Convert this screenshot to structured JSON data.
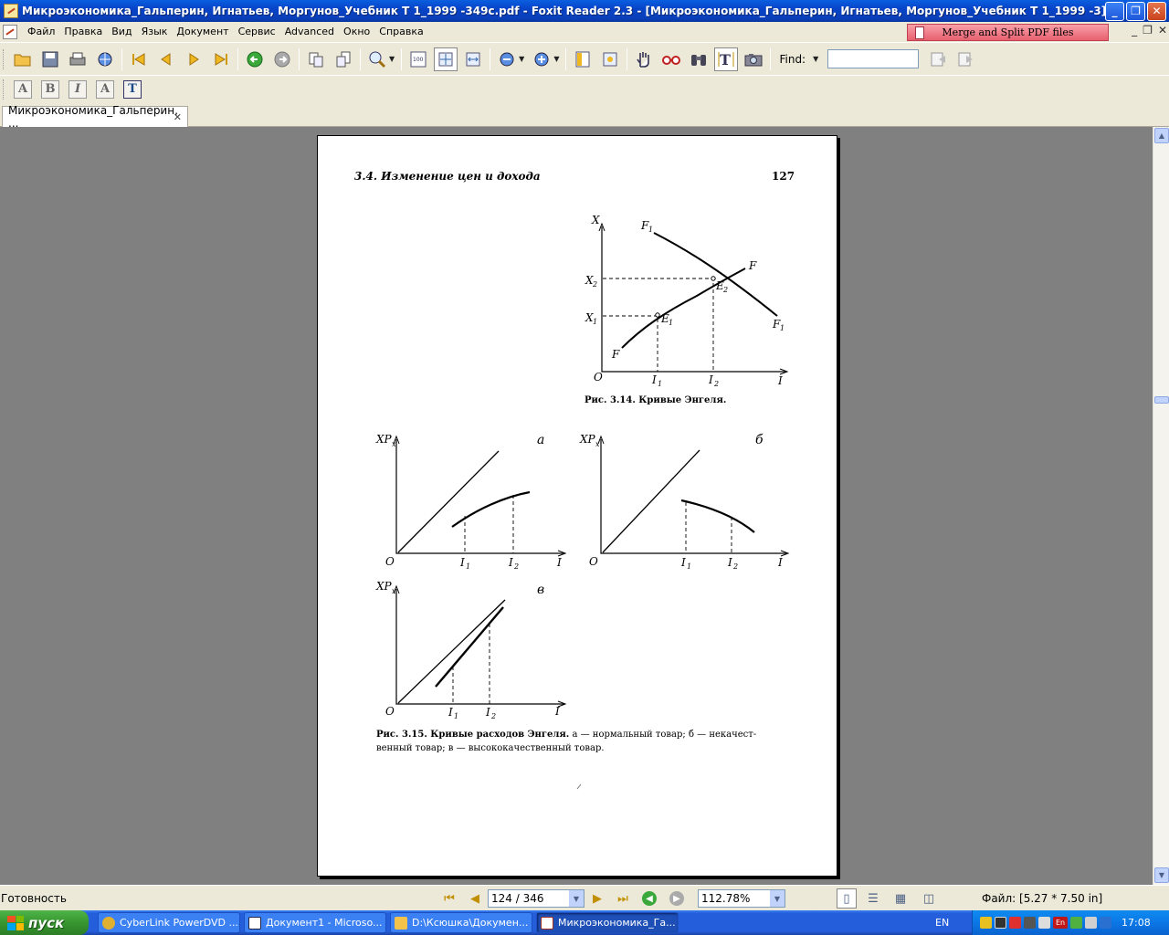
{
  "window": {
    "title": "Микроэкономика_Гальперин, Игнатьев, Моргунов_Учебник Т 1_1999 -349с.pdf - Foxit Reader 2.3 - [Микроэкономика_Гальперин, Игнатьев, Моргунов_Учебник Т 1_1999 -3]",
    "minimize": "_",
    "maximize": "❐",
    "close": "✕"
  },
  "menu": {
    "items": [
      "Файл",
      "Правка",
      "Вид",
      "Язык",
      "Документ",
      "Сервис",
      "Advanced",
      "Окно",
      "Справка"
    ],
    "ad_banner": "Merge and Split PDF files"
  },
  "toolbar": {
    "find_label": "Find:",
    "find_value": ""
  },
  "tabs": [
    {
      "label": "Микроэкономика_Гальперин, ...",
      "close": "✕"
    }
  ],
  "page": {
    "header_title": "3.4. Изменение цен и дохода",
    "page_number": "127",
    "fig1": {
      "labels": {
        "x_axis": "X",
        "i_axis": "I",
        "origin": "O",
        "x1": "X",
        "x1_sub": "1",
        "x2": "X",
        "x2_sub": "2",
        "i1": "I",
        "i1_sub": "1",
        "i2": "I",
        "i2_sub": "2",
        "f_lower": "F",
        "f_upper": "F",
        "f1_top": "F",
        "f1_top_sub": "1",
        "f1_bottom": "F",
        "f1_bottom_sub": "1",
        "e1": "E",
        "e1_sub": "1",
        "e2": "E",
        "e2_sub": "2"
      },
      "caption_bold": "Рис. 3.14. Кривые Энгеля."
    },
    "fig2": {
      "panel_a": {
        "ylabel": "XP",
        "ylabel_sub": "x",
        "letter": "а",
        "origin": "O",
        "xaxis": "I",
        "i1": "I",
        "i1_sub": "1",
        "i2": "I",
        "i2_sub": "2"
      },
      "panel_b": {
        "ylabel": "XP",
        "ylabel_sub": "x",
        "letter": "б",
        "origin": "O",
        "xaxis": "I",
        "i1": "I",
        "i1_sub": "1",
        "i2": "I",
        "i2_sub": "2"
      },
      "panel_c": {
        "ylabel": "XP",
        "ylabel_sub": "x",
        "letter": "в",
        "origin": "O",
        "xaxis": "I",
        "i1": "I",
        "i1_sub": "1",
        "i2": "I",
        "i2_sub": "2"
      },
      "caption_bold": "Рис. 3.15. Кривые расходов Энгеля.",
      "caption_line1": " а — нормальный товар; б — некачест-",
      "caption_line2": "венный товар; в — высококачественный товар."
    }
  },
  "status": {
    "text": "Готовность",
    "page_indicator": "124 / 346",
    "zoom": "112.78%",
    "file_info": "Файл: [5.27 * 7.50 in]"
  },
  "taskbar": {
    "start": "пуск",
    "tasks": [
      "CyberLink PowerDVD ...",
      "Документ1 - Microso...",
      "D:\\Ксюшка\\Докумен...",
      "Микроэкономика_Га..."
    ],
    "lang": "EN",
    "tray_lang": "En",
    "clock": "17:08"
  }
}
